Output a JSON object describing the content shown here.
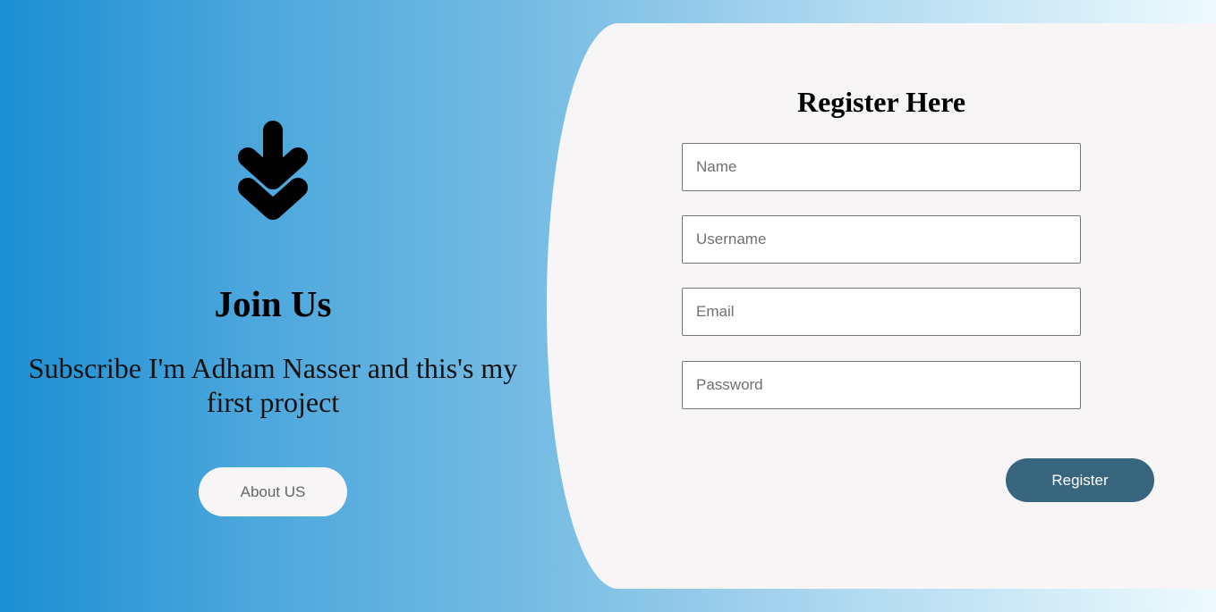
{
  "hero": {
    "icon": "double-arrow-down-icon",
    "title": "Join Us",
    "subtitle": "Subscribe I'm Adham Nasser and this's my first project",
    "about_button_label": "About US"
  },
  "form": {
    "title": "Register Here",
    "fields": [
      {
        "name": "name",
        "placeholder": "Name",
        "value": ""
      },
      {
        "name": "username",
        "placeholder": "Username",
        "value": ""
      },
      {
        "name": "email",
        "placeholder": "Email",
        "value": ""
      },
      {
        "name": "password",
        "placeholder": "Password",
        "value": ""
      }
    ],
    "submit_label": "Register"
  },
  "colors": {
    "gradient_start": "#1b8fd3",
    "gradient_end": "#eefafd",
    "panel_background": "#f7f5f6",
    "register_button": "#38667f",
    "about_button": "#f7f5f6"
  }
}
